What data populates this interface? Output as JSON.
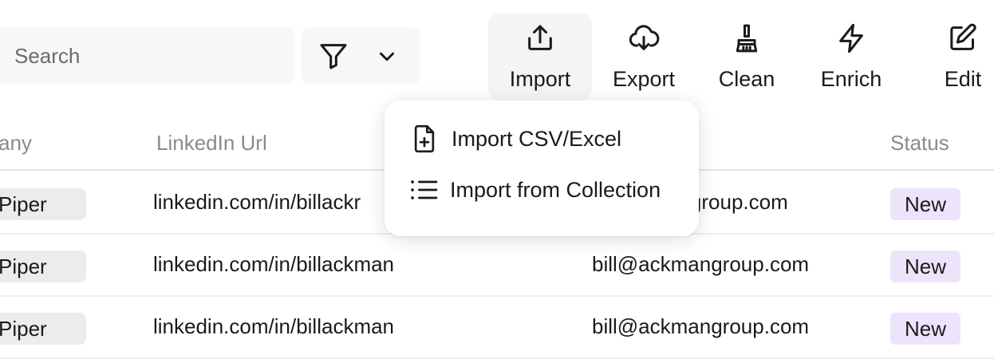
{
  "search": {
    "placeholder": "Search",
    "value": ""
  },
  "toolbar": {
    "import_label": "Import",
    "export_label": "Export",
    "clean_label": "Clean",
    "enrich_label": "Enrich",
    "edit_label": "Edit"
  },
  "table": {
    "headers": {
      "company": "any",
      "linkedin": "LinkedIn Url",
      "status": "Status"
    },
    "rows": [
      {
        "company": "Piper",
        "linkedin": "linkedin.com/in/billackr",
        "email": "angroup.com",
        "status": "New"
      },
      {
        "company": "Piper",
        "linkedin": "linkedin.com/in/billackman",
        "email": "bill@ackmangroup.com",
        "status": "New"
      },
      {
        "company": "Piper",
        "linkedin": "linkedin.com/in/billackman",
        "email": "bill@ackmangroup.com",
        "status": "New"
      }
    ]
  },
  "import_menu": {
    "items": [
      {
        "label": "Import CSV/Excel",
        "icon": "file-plus-icon"
      },
      {
        "label": "Import from Collection",
        "icon": "list-icon"
      }
    ]
  },
  "colors": {
    "status_new_bg": "#ede4fb",
    "chip_bg": "#ececec",
    "search_bg": "#f6f7f6"
  }
}
